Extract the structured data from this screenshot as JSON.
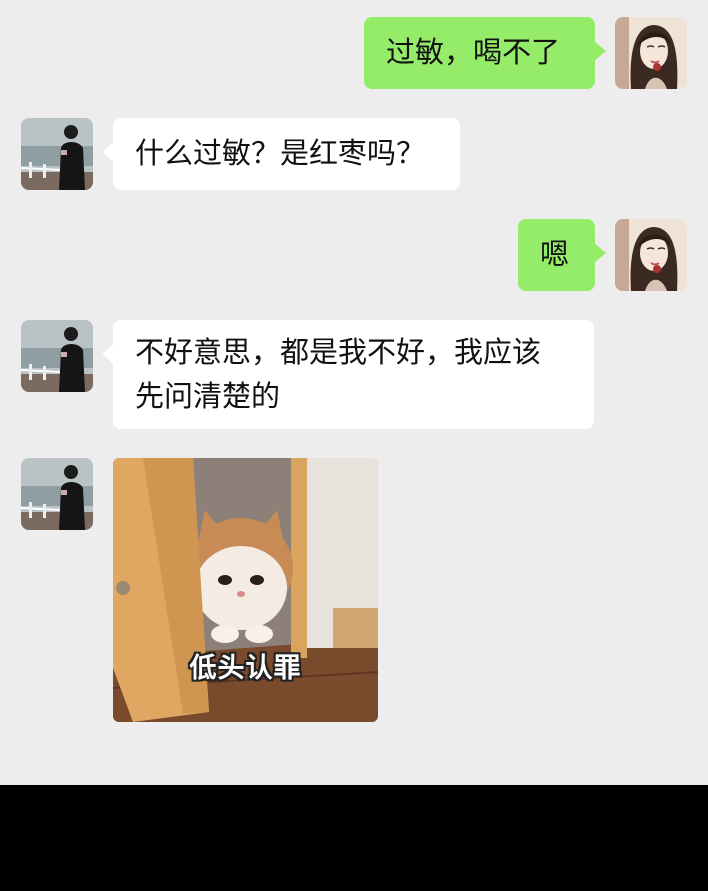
{
  "conversation": {
    "messages": [
      {
        "sender": "me",
        "text": "过敏，喝不了"
      },
      {
        "sender": "them",
        "text": "什么过敏？是红枣吗？"
      },
      {
        "sender": "me",
        "text": "嗯"
      },
      {
        "sender": "them",
        "lines": [
          "不好意思，都是我不好，我应该",
          "先问清楚的"
        ]
      },
      {
        "sender": "them",
        "type": "sticker",
        "caption": "低头认罪",
        "subject": "cat-peeking-through-door"
      }
    ]
  },
  "colors": {
    "background": "#ededed",
    "my_bubble": "#95ec69",
    "their_bubble": "#ffffff"
  },
  "icons": {
    "my_avatar": "woman-portrait-avatar",
    "their_avatar": "man-by-sea-avatar"
  }
}
